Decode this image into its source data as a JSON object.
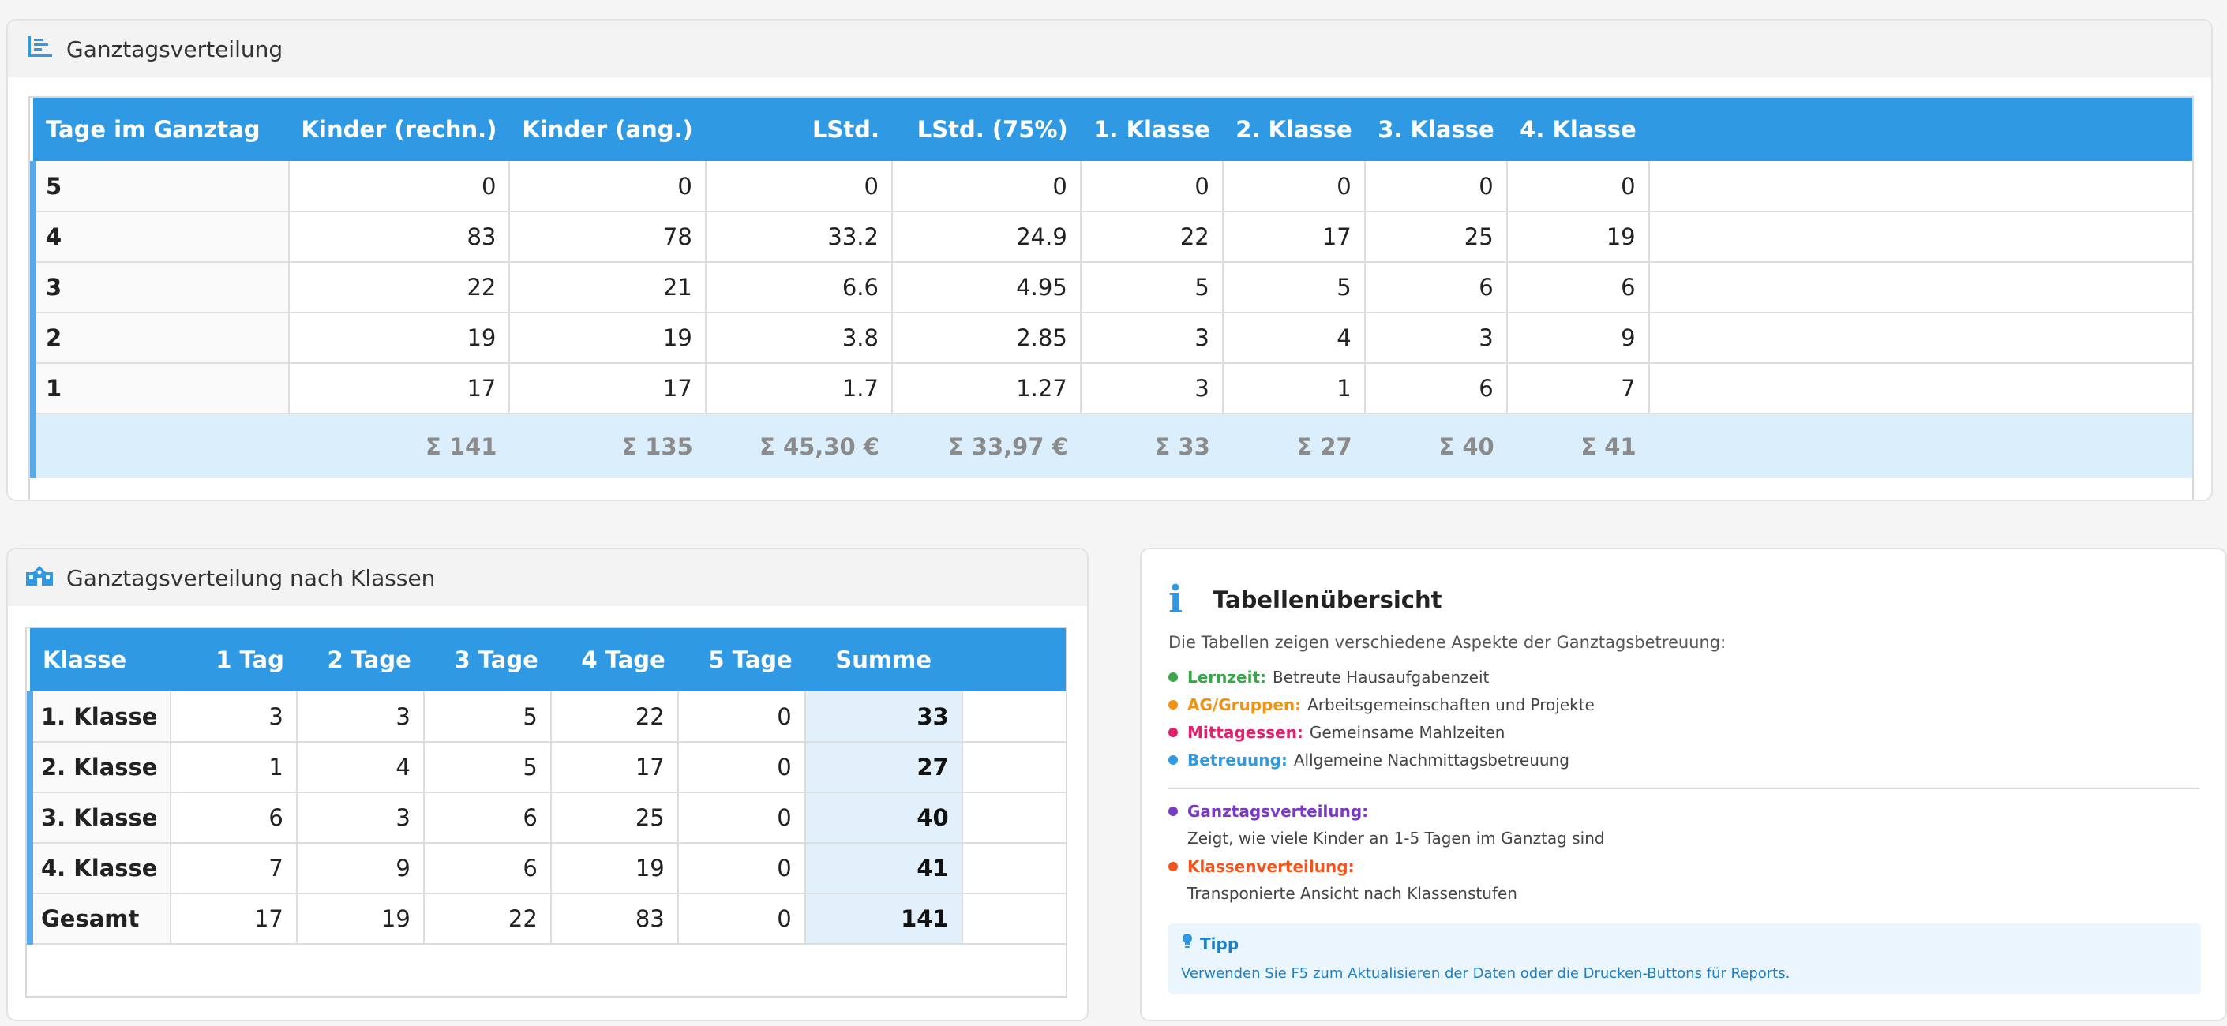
{
  "ganztag": {
    "title": "Ganztagsverteilung",
    "columns": [
      "Tage im Ganztag",
      "Kinder (rechn.)",
      "Kinder (ang.)",
      "LStd.",
      "LStd. (75%)",
      "1. Klasse",
      "2. Klasse",
      "3. Klasse",
      "4. Klasse"
    ],
    "rows": [
      [
        "5",
        "0",
        "0",
        "0",
        "0",
        "0",
        "0",
        "0",
        "0"
      ],
      [
        "4",
        "83",
        "78",
        "33.2",
        "24.9",
        "22",
        "17",
        "25",
        "19"
      ],
      [
        "3",
        "22",
        "21",
        "6.6",
        "4.95",
        "5",
        "5",
        "6",
        "6"
      ],
      [
        "2",
        "19",
        "19",
        "3.8",
        "2.85",
        "3",
        "4",
        "3",
        "9"
      ],
      [
        "1",
        "17",
        "17",
        "1.7",
        "1.27",
        "3",
        "1",
        "6",
        "7"
      ]
    ],
    "sums": [
      "",
      "Σ 141",
      "Σ 135",
      "Σ 45,30 €",
      "Σ 33,97 €",
      "Σ 33",
      "Σ 27",
      "Σ 40",
      "Σ 41"
    ]
  },
  "klassen": {
    "title": "Ganztagsverteilung nach Klassen",
    "columns": [
      "Klasse",
      "1 Tag",
      "2 Tage",
      "3 Tage",
      "4 Tage",
      "5 Tage",
      "Summe"
    ],
    "rows": [
      [
        "1. Klasse",
        "3",
        "3",
        "5",
        "22",
        "0",
        "33"
      ],
      [
        "2. Klasse",
        "1",
        "4",
        "5",
        "17",
        "0",
        "27"
      ],
      [
        "3. Klasse",
        "6",
        "3",
        "6",
        "25",
        "0",
        "40"
      ],
      [
        "4. Klasse",
        "7",
        "9",
        "6",
        "19",
        "0",
        "41"
      ],
      [
        "Gesamt",
        "17",
        "19",
        "22",
        "83",
        "0",
        "141"
      ]
    ]
  },
  "info": {
    "title": "Tabellenübersicht",
    "intro": "Die Tabellen zeigen verschiedene Aspekte der Ganztagsbetreuung:",
    "legend": [
      {
        "key": "Lernzeit:",
        "text": "Betreute Hausaufgabenzeit",
        "color": "#3aa64a"
      },
      {
        "key": "AG/Gruppen:",
        "text": "Arbeitsgemeinschaften und Projekte",
        "color": "#f2920f"
      },
      {
        "key": "Mittagessen:",
        "text": "Gemeinsame Mahlzeiten",
        "color": "#e3206d"
      },
      {
        "key": "Betreuung:",
        "text": "Allgemeine Nachmittagsbetreuung",
        "color": "#2f9ae3"
      }
    ],
    "sections": [
      {
        "key": "Ganztagsverteilung:",
        "text": "Zeigt, wie viele Kinder an 1-5 Tagen im Ganztag sind",
        "color": "#7a3bc4"
      },
      {
        "key": "Klassenverteilung:",
        "text": "Transponierte Ansicht nach Klassenstufen",
        "color": "#f2541b"
      }
    ],
    "tip_title": "Tipp",
    "tip_text": "Verwenden Sie F5 zum Aktualisieren der Daten oder die Drucken-Buttons für Reports."
  },
  "icons": {
    "panel1": "bar-chart-icon",
    "panel2": "school-icon",
    "info": "info-icon",
    "tip": "lightbulb-icon"
  },
  "colors": {
    "accent": "#2f9ae3",
    "sum_row_bg": "#dbeefb"
  }
}
